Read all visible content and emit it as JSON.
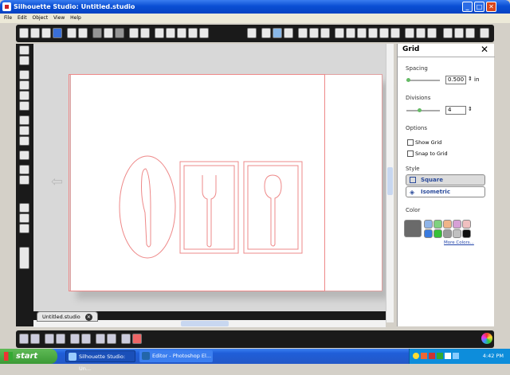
{
  "window": {
    "title": "Silhouette Studio: Untitled.studio"
  },
  "menu": [
    "File",
    "Edit",
    "Object",
    "View",
    "Help"
  ],
  "document_tab": {
    "label": "Untitled.studio",
    "close": "✕"
  },
  "panel": {
    "title": "Grid",
    "close_glyph": "✕",
    "spacing_label": "Spacing",
    "spacing_value": "0.500",
    "spacing_unit": "in",
    "divisions_label": "Divisions",
    "divisions_value": "4",
    "options_label": "Options",
    "show_grid_label": "Show Grid",
    "snap_to_grid_label": "Snap to Grid",
    "style_label": "Style",
    "style_square": "Square",
    "style_isometric": "Isometric",
    "color_label": "Color",
    "more_colors": "More Colors...",
    "colors": [
      "#8fb4e8",
      "#7fd27f",
      "#f0b488",
      "#d6a0d6",
      "#f0c0c0",
      "#3a7be0",
      "#38c038",
      "#9a9a9a",
      "#c0c0c0",
      "#101010"
    ],
    "selected_color": "#6a6a6a"
  },
  "taskbar": {
    "start_label": "start",
    "tasks": [
      "Silhouette Studio: Un...",
      "Editor - Photoshop El..."
    ],
    "clock": "4:42 PM"
  }
}
